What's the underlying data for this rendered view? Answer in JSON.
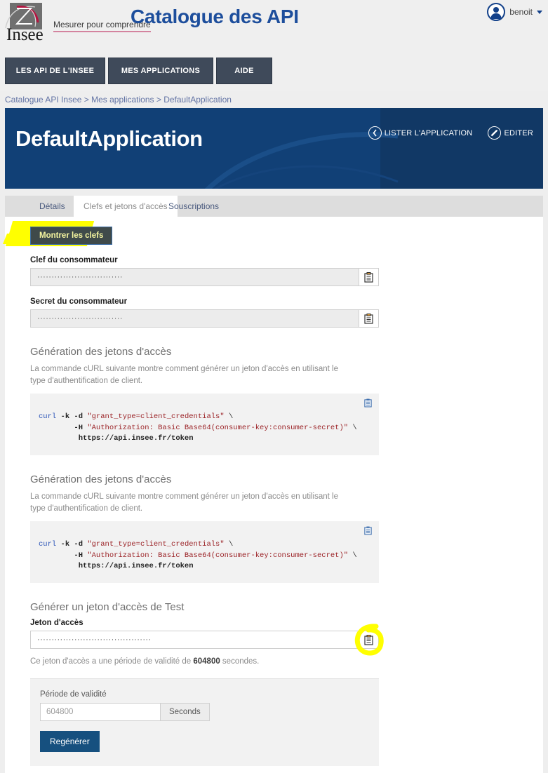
{
  "header": {
    "logo_text": "Insee",
    "tagline": "Mesurer pour comprendre",
    "title": "Catalogue des API",
    "user_name": "benoit",
    "avatar_icon": "user-avatar-icon",
    "caret_icon": "chevron-down-icon"
  },
  "nav": {
    "items": [
      {
        "label": "LES API DE L'INSEE"
      },
      {
        "label": "MES APPLICATIONS"
      },
      {
        "label": "AIDE"
      }
    ]
  },
  "breadcrumb": {
    "items": [
      "Catalogue API Insee",
      "Mes applications",
      "DefaultApplication"
    ],
    "separator": " > "
  },
  "banner": {
    "title": "DefaultApplication",
    "actions": [
      {
        "label": "LISTER L'APPLICATION",
        "icon": "chevron-left-circle-icon"
      },
      {
        "label": "EDITER",
        "icon": "pencil-circle-icon"
      }
    ]
  },
  "tabs": [
    {
      "label": "Détails",
      "active": false
    },
    {
      "label": "Clefs et jetons d'accès",
      "active": true
    },
    {
      "label": "Souscriptions",
      "active": false
    }
  ],
  "keys": {
    "show_keys_button": "Montrer les clefs",
    "consumer_key_label": "Clef du consommateur",
    "consumer_key_value": "······························",
    "consumer_secret_label": "Secret du consommateur",
    "consumer_secret_value": "······························",
    "copy_icon": "clipboard-copy-icon"
  },
  "token_sections": [
    {
      "title": "Génération des jetons d'accès",
      "description": "La commande cURL suivante montre comment générer un jeton d'accès en utilisant le type d'authentification de client.",
      "code": {
        "cmd": "curl",
        "flags1": " -k -d ",
        "str1": "\"grant_type=client_credentials\"",
        "cont1": " \\",
        "flags2": "        -H ",
        "str2": "\"Authorization: Basic Base64(consumer-key:consumer-secret)\"",
        "cont2": " \\",
        "url": "         https://api.insee.fr/token"
      },
      "copy_icon": "clipboard-copy-icon"
    },
    {
      "title": "Génération des jetons d'accès",
      "description": "La commande cURL suivante montre comment générer un jeton d'accès en utilisant le type d'authentification de client.",
      "code": {
        "cmd": "curl",
        "flags1": " -k -d ",
        "str1": "\"grant_type=client_credentials\"",
        "cont1": " \\",
        "flags2": "        -H ",
        "str2": "\"Authorization: Basic Base64(consumer-key:consumer-secret)\"",
        "cont2": " \\",
        "url": "         https://api.insee.fr/token"
      },
      "copy_icon": "clipboard-copy-icon"
    }
  ],
  "test_token": {
    "title": "Générer un jeton d'accès de Test",
    "field_label": "Jeton d'accès",
    "field_value": "········································",
    "copy_icon": "clipboard-copy-icon",
    "note_prefix": "Ce jeton d'accès a une période de validité de ",
    "note_value": "604800",
    "note_suffix": " secondes."
  },
  "validity_panel": {
    "label": "Période de validité",
    "input_value": "604800",
    "input_placeholder": "604800",
    "unit": "Seconds",
    "button": "Regénérer"
  },
  "annotations": {
    "highlight_color": "#ffff00",
    "marks": [
      "highlight-over-show-keys-button",
      "circle-around-token-copy-icon"
    ]
  },
  "colors": {
    "brand_blue": "#114076",
    "banner_right": "#113865",
    "nav_dark": "#3f4a5a",
    "title_blue": "#1d4e9c",
    "button_blue": "#16507f"
  }
}
